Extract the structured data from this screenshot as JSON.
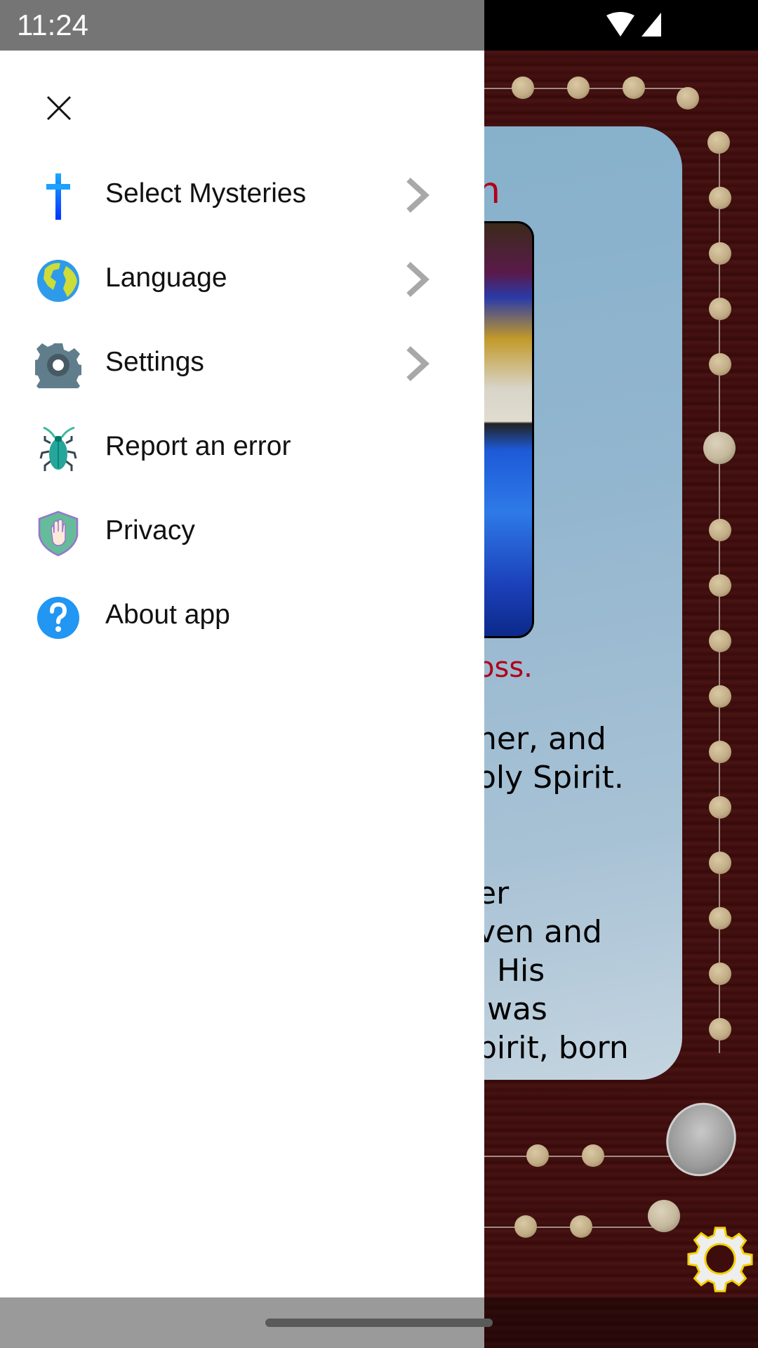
{
  "status_bar": {
    "time": "11:24",
    "icons": [
      "wifi-icon",
      "signal-icon"
    ]
  },
  "drawer": {
    "close_icon": "close-icon",
    "items": [
      {
        "label": "Select Mysteries",
        "icon": "cross-icon",
        "has_submenu": true
      },
      {
        "label": "Language",
        "icon": "globe-icon",
        "has_submenu": true
      },
      {
        "label": "Settings",
        "icon": "gear-icon",
        "has_submenu": true
      },
      {
        "label": "Report an error",
        "icon": "bug-icon",
        "has_submenu": false
      },
      {
        "label": "Privacy",
        "icon": "shield-hand-icon",
        "has_submenu": false
      },
      {
        "label": "About app",
        "icon": "question-icon",
        "has_submenu": false
      }
    ]
  },
  "background_app": {
    "title_fragment": "n",
    "caption_fragment": "oss.",
    "prayer_fragment": "ner, and\noly Spirit.\n\n\ner\nven and\n, His\n was\npirit, born",
    "colors": {
      "title": "#b00018",
      "card": "#93b6cf",
      "wood": "#3d0d0d",
      "gear_outline": "#f2d000"
    }
  }
}
